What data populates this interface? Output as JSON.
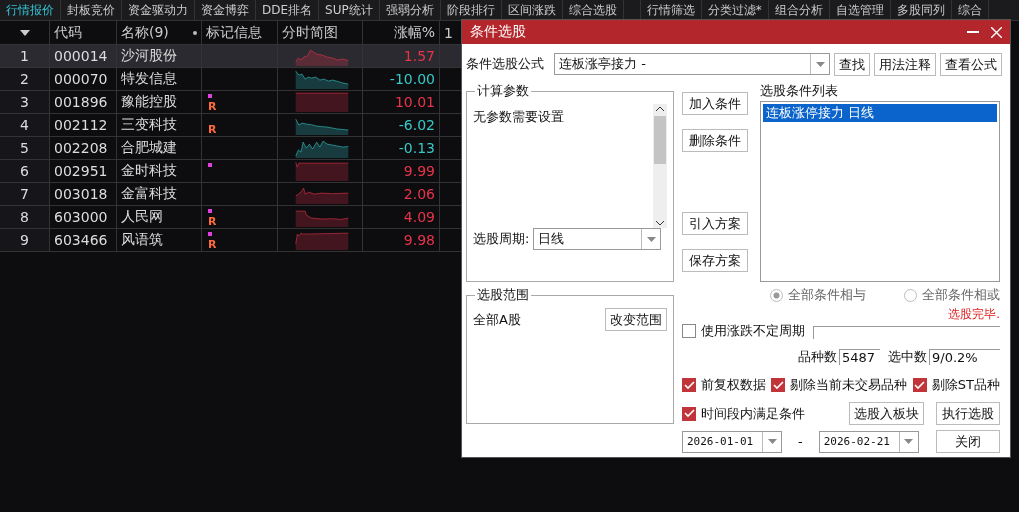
{
  "tabs": [
    {
      "label": "行情报价",
      "selected": true
    },
    {
      "label": "封板竞价",
      "selected": false
    },
    {
      "label": "资金驱动力",
      "selected": false
    },
    {
      "label": "资金博弈",
      "selected": false
    },
    {
      "label": "DDE排名",
      "selected": false
    },
    {
      "label": "SUP统计",
      "selected": false
    },
    {
      "label": "强弱分析",
      "selected": false
    },
    {
      "label": "阶段排行",
      "selected": false
    },
    {
      "label": "区间涨跌",
      "selected": false
    },
    {
      "label": "综合选股",
      "selected": false
    }
  ],
  "tabs_right": [
    {
      "label": "行情筛选",
      "selected": false
    },
    {
      "label": "分类过滤*",
      "selected": false
    },
    {
      "label": "组合分析",
      "selected": false
    },
    {
      "label": "自选管理",
      "selected": false
    },
    {
      "label": "多股同列",
      "selected": false
    },
    {
      "label": "综合",
      "selected": false
    }
  ],
  "table": {
    "columns": [
      "代码",
      "名称(9)",
      "标记信息",
      "分时简图",
      "涨幅%",
      "1"
    ],
    "rows": [
      {
        "index": "1",
        "code": "000014",
        "name": "沙河股份",
        "dot": false,
        "pct": "1.57",
        "rising": true,
        "selected": true
      },
      {
        "index": "2",
        "code": "000070",
        "name": "特发信息",
        "dot": false,
        "pct": "-10.00",
        "rising": false,
        "selected": false
      },
      {
        "index": "3",
        "code": "001896",
        "name": "豫能控股",
        "dot": true,
        "tag": "R",
        "pct": "10.01",
        "rising": true,
        "selected": false
      },
      {
        "index": "4",
        "code": "002112",
        "name": "三变科技",
        "dot": false,
        "tag": "R",
        "pct": "-6.02",
        "rising": false,
        "selected": false
      },
      {
        "index": "5",
        "code": "002208",
        "name": "合肥城建",
        "dot": false,
        "pct": "-0.13",
        "rising": false,
        "selected": false
      },
      {
        "index": "6",
        "code": "002951",
        "name": "金时科技",
        "dot": true,
        "pct": "9.99",
        "rising": true,
        "selected": false
      },
      {
        "index": "7",
        "code": "003018",
        "name": "金富科技",
        "dot": false,
        "pct": "2.06",
        "rising": true,
        "selected": false
      },
      {
        "index": "8",
        "code": "603000",
        "name": "人民网",
        "dot": true,
        "tag": "R",
        "pct": "4.09",
        "rising": true,
        "selected": false
      },
      {
        "index": "9",
        "code": "603466",
        "name": "风语筑",
        "dot": true,
        "tag": "R",
        "pct": "9.98",
        "rising": true,
        "selected": false
      }
    ]
  },
  "dialog": {
    "title": "条件选股",
    "formula_label": "条件选股公式",
    "formula_value": "连板涨亭接力  -",
    "formula_buttons": [
      "查找",
      "用法注释",
      "查看公式"
    ],
    "params_group": "计算参数",
    "params_text": "无参数需要设置",
    "period_label": "选股周期:",
    "period_value": "日线",
    "middle_buttons": [
      "加入条件",
      "删除条件",
      "引入方案",
      "保存方案"
    ],
    "list_label": "选股条件列表",
    "conditions": [
      {
        "text": "连板涨停接力  日线",
        "selected": true
      }
    ],
    "radios": [
      {
        "label": "全部条件相与",
        "selected": true,
        "disabled": true
      },
      {
        "label": "全部条件相或",
        "selected": false,
        "disabled": true
      }
    ],
    "status": "选股完毕.",
    "range_group": "选股范围",
    "range_value": "全部A股",
    "range_button": "改变范围",
    "variable_period": {
      "label": "使用涨跌不定周期",
      "checked": false
    },
    "count_label": "品种数",
    "count_value": "5487",
    "selected_label": "选中数",
    "selected_value": "9/0.2%",
    "options": [
      {
        "label": "前复权数据",
        "checked": true
      },
      {
        "label": "剔除当前未交易品种",
        "checked": true
      },
      {
        "label": "剔除ST品种",
        "checked": true
      }
    ],
    "time_option": {
      "label": "时间段内满足条件",
      "checked": true
    },
    "add_block_button": "选股入板块",
    "run_button": "执行选股",
    "close_button": "关闭",
    "date_from": "2026-01-01",
    "date_sep": "-",
    "date_to": "2026-02-21"
  }
}
